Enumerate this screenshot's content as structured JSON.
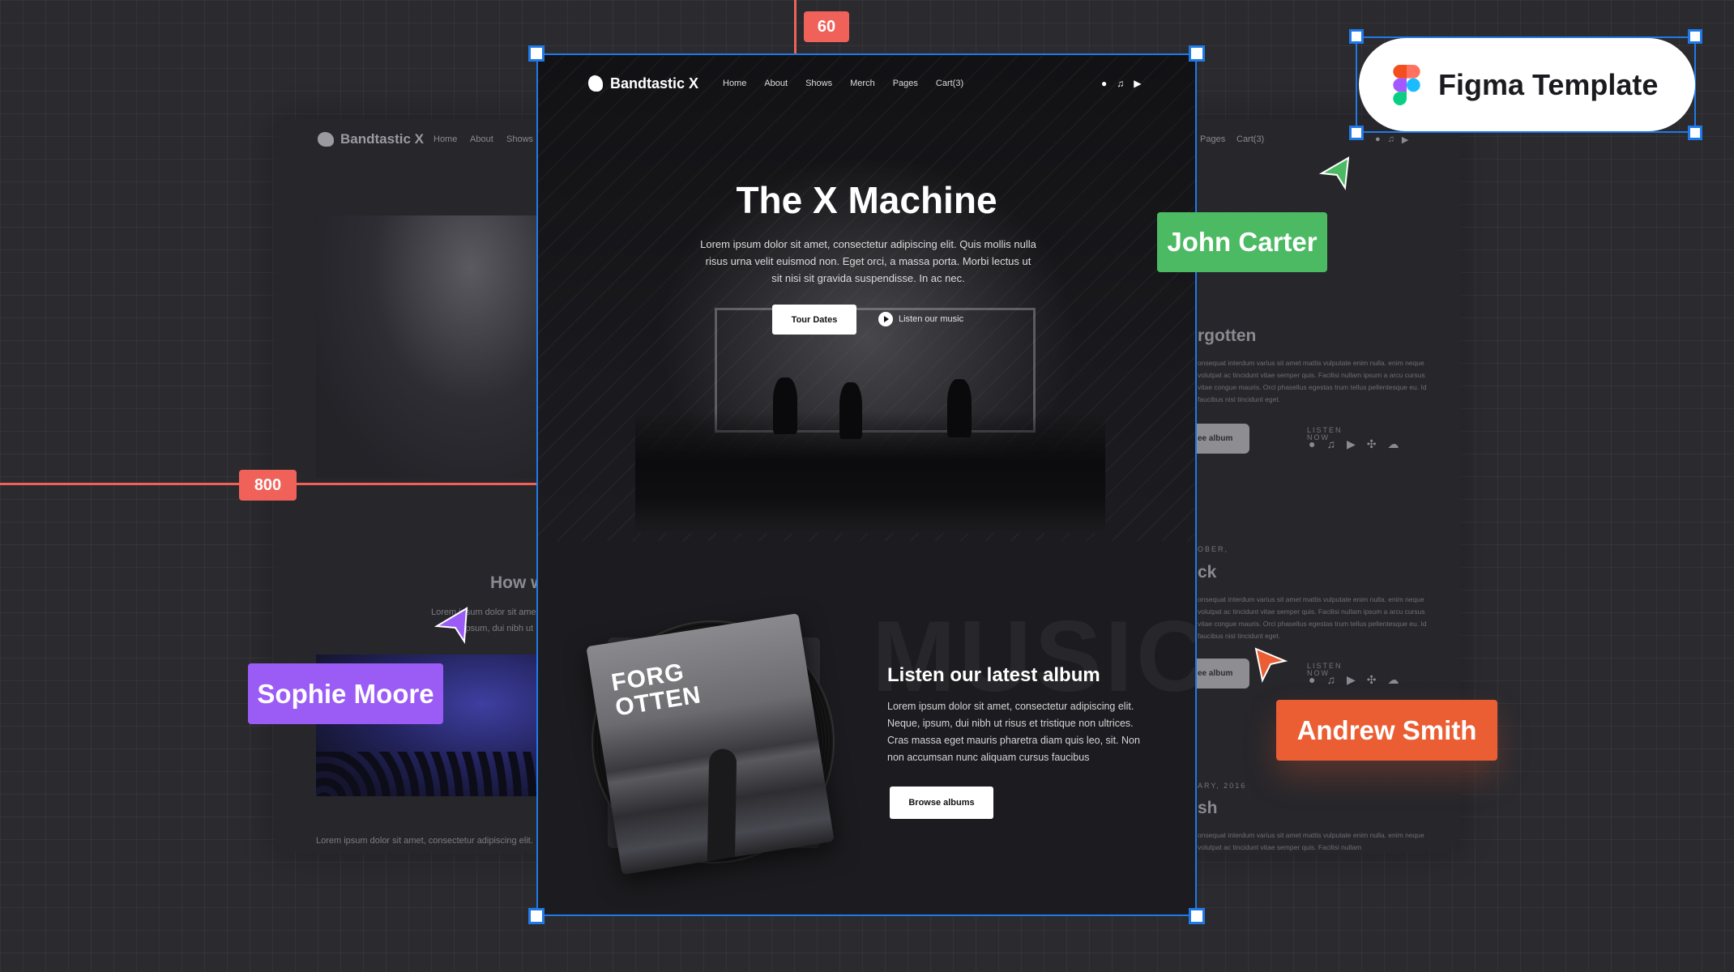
{
  "canvas": {
    "top_measure": "60",
    "left_measure": "800",
    "colors": {
      "selection": "#1f7ae8",
      "measure": "#f0615a"
    }
  },
  "figma_badge": {
    "label": "Figma Template"
  },
  "collaborators": [
    {
      "name": "John Carter",
      "color": "#4cb963"
    },
    {
      "name": "Sophie Moore",
      "color": "#9b5cf6"
    },
    {
      "name": "Andrew Smith",
      "color": "#eb5e33"
    }
  ],
  "site": {
    "brand": "Bandtastic X",
    "nav": [
      "Home",
      "About",
      "Shows",
      "Merch",
      "Pages",
      "Cart(3)"
    ],
    "socials": [
      "spotify-icon",
      "music-note-icon",
      "youtube-icon"
    ],
    "hero": {
      "title": "The X Machine",
      "text": "Lorem ipsum dolor sit amet, consectetur adipiscing elit. Quis mollis nulla risus urna velit euismod non. Eget orci, a massa porta. Morbi lectus ut sit nisi sit gravida suspendisse. In ac nec.",
      "primary": "Tour Dates",
      "secondary": "Listen our music"
    },
    "album": {
      "bg_word": "MUSIC",
      "cover_title": "FORG OTTEN",
      "title": "Listen our latest album",
      "text": "Lorem ipsum dolor sit amet, consectetur adipiscing elit. Neque, ipsum, dui nibh ut risus et tristique non ultrices. Cras massa eget mauris pharetra diam quis leo, sit. Non non accumsan nunc aliquam cursus faucibus",
      "button": "Browse albums"
    }
  },
  "bg_page": {
    "brand": "Bandtastic X",
    "nav_left": [
      "Home",
      "About",
      "Shows"
    ],
    "nav_right": [
      "Pages",
      "Cart(3)"
    ],
    "left_heading": "How w",
    "left_text_1": "Lorem ipsum dolor sit ame",
    "left_text_2": "ipsum, dui nibh ut",
    "left_bottom": "Lorem ipsum dolor sit amet, consectetur adipiscing elit.",
    "albums": [
      {
        "date": "",
        "title": "rgotten",
        "text": "onsequat interdum varius sit amet mattis vulputate enim nulla. enim neque volutpat ac tincidunt vitae semper quis. Facilisi nullam ipsum a arcu cursus vitae congue mauris. Orci phasellus egestas trum tellus pellentesque eu. Id faucibus nisl tincidunt eget.",
        "button": "ee album",
        "listen": "LISTEN NOW"
      },
      {
        "date": "OBER,",
        "title": "ck",
        "text": "onsequat interdum varius sit amet mattis vulputate enim nulla. enim neque volutpat ac tincidunt vitae semper quis. Facilisi nullam ipsum a arcu cursus vitae congue mauris. Orci phasellus egestas trum tellus pellentesque eu. Id faucibus nisl tincidunt eget.",
        "button": "ee album",
        "listen": "LISTEN NOW"
      },
      {
        "date": "ARY, 2016",
        "title": "sh",
        "text": "onsequat interdum varius sit amet mattis vulputate enim nulla. enim neque volutpat ac tincidunt vitae semper quis. Facilisi nullam"
      }
    ]
  }
}
